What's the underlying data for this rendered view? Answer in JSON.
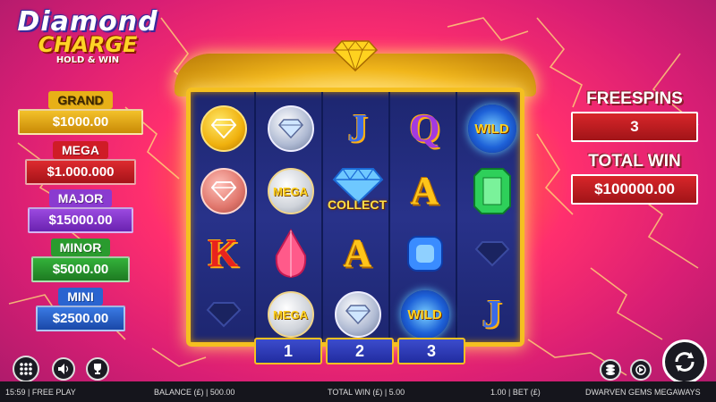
{
  "logo": {
    "line1": "Diamond",
    "line2": "CHARGE",
    "line3": "HOLD & WIN"
  },
  "jackpots": [
    {
      "label": "GRAND",
      "value": "$1000.00",
      "label_color": "#ffd326",
      "bg": "#e8b017"
    },
    {
      "label": "MEGA",
      "value": "$1.000.000",
      "label_color": "#ffffff",
      "bg": "#cf1c26"
    },
    {
      "label": "MAJOR",
      "value": "$15000.00",
      "label_color": "#ffffff",
      "bg": "#8a3bd0"
    },
    {
      "label": "MINOR",
      "value": "$5000.00",
      "label_color": "#ffffff",
      "bg": "#2a9b2e"
    },
    {
      "label": "MINI",
      "value": "$2500.00",
      "label_color": "#ffffff",
      "bg": "#2a64d0"
    }
  ],
  "reels": [
    [
      "gold-coin-diamond",
      "pink-coin-diamond",
      "K",
      "diamond-shadow"
    ],
    [
      "silver-coin-diamond",
      "MEGA",
      "ruby-drop",
      "MEGA"
    ],
    [
      "J",
      "blue-diamond",
      "A",
      "silver-coin-diamond"
    ],
    [
      "Q",
      "A",
      "blue-gem",
      "WILD"
    ],
    [
      "WILD",
      "emerald",
      "diamond-shadow",
      "J"
    ]
  ],
  "symbols": {
    "mega_label": "MEGA",
    "wild_label": "WILD",
    "collect_label": "COLLECT",
    "k": "K",
    "j": "J",
    "q": "Q",
    "a": "A"
  },
  "reel_numbers": [
    "1",
    "2",
    "3"
  ],
  "freespins": {
    "label": "FREESPINS",
    "value": "3"
  },
  "total_win": {
    "label": "TOTAL WIN",
    "value": "$100000.00"
  },
  "status": {
    "time_mode": "15:59 | FREE PLAY",
    "balance": "BALANCE (£) | 500.00",
    "total_win": "TOTAL WIN (£) | 5.00",
    "bet": "1.00 | BET (£)",
    "game": "DWARVEN GEMS MEGAWAYS"
  },
  "controls": {
    "menu_icon": "grid-menu-icon",
    "sound_icon": "speaker-icon",
    "trophy_icon": "trophy-icon",
    "coins_icon": "coin-stack-icon",
    "autoplay_icon": "autoplay-icon",
    "spin_icon": "spin-arrows-icon"
  }
}
